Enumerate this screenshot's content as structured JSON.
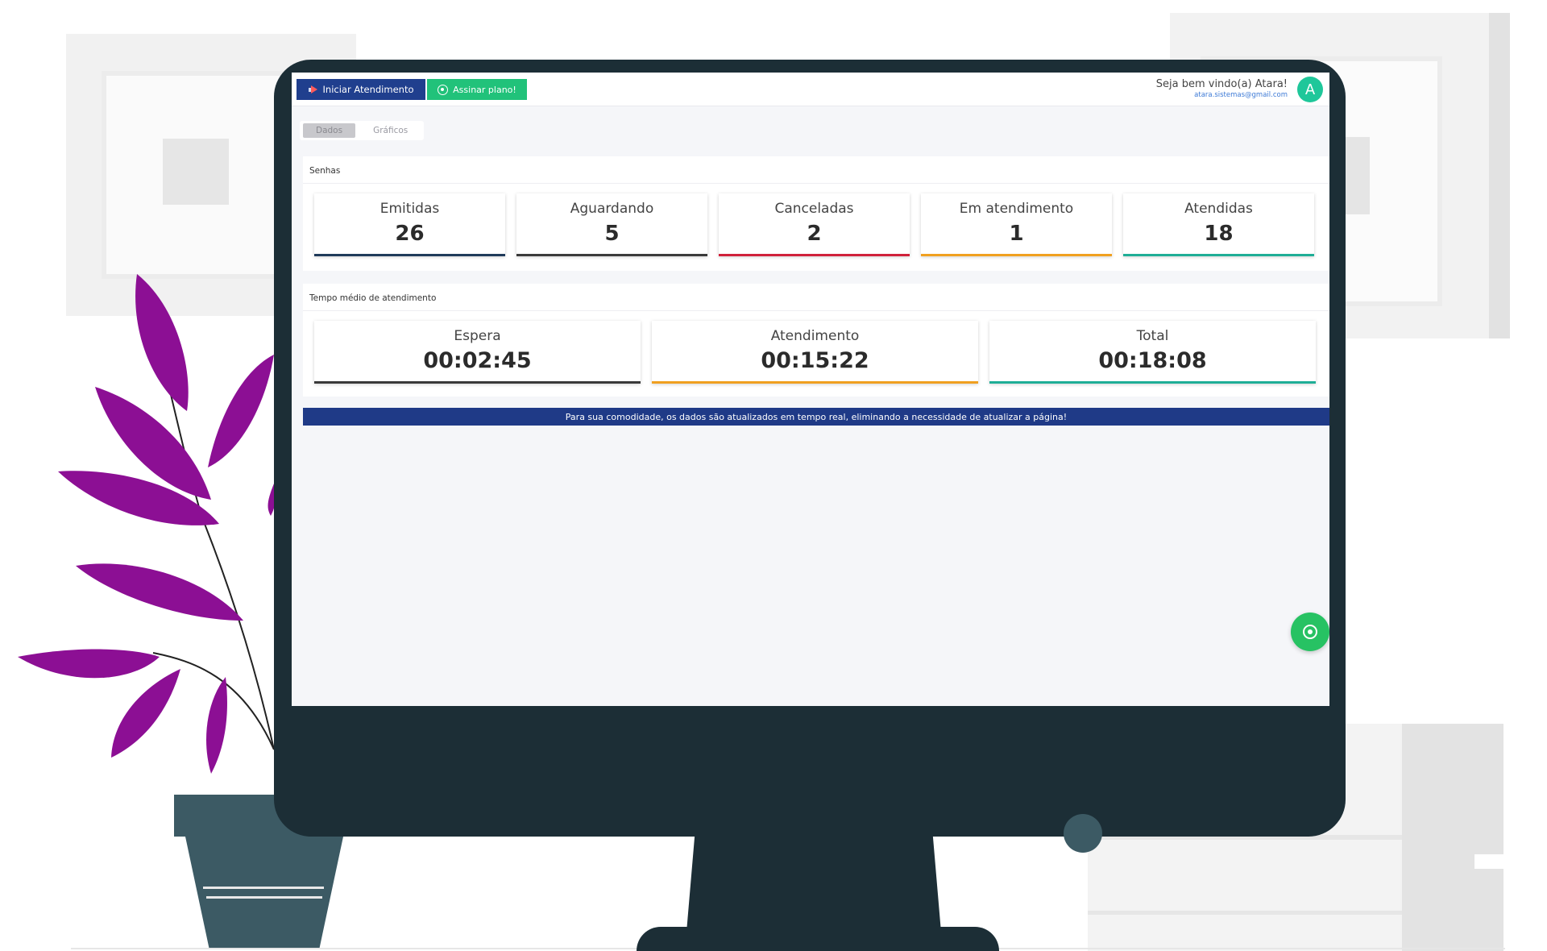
{
  "toolbar": {
    "start_label": "Iniciar Atendimento",
    "plan_label": "Assinar plano!"
  },
  "user": {
    "welcome": "Seja bem vindo(a) Atara!",
    "email": "atara.sistemas@gmail.com",
    "avatar_initial": "A"
  },
  "tabs": [
    {
      "label": "Dados",
      "active": true
    },
    {
      "label": "Gráficos",
      "active": false
    }
  ],
  "senhas": {
    "title": "Senhas",
    "cards": [
      {
        "label": "Emitidas",
        "value": "26",
        "color": "#1f3a5a"
      },
      {
        "label": "Aguardando",
        "value": "5",
        "color": "#3a3a3a"
      },
      {
        "label": "Canceladas",
        "value": "2",
        "color": "#d0213a"
      },
      {
        "label": "Em atendimento",
        "value": "1",
        "color": "#f0a020"
      },
      {
        "label": "Atendidas",
        "value": "18",
        "color": "#1fae96"
      }
    ]
  },
  "tempo": {
    "title": "Tempo médio de atendimento",
    "cards": [
      {
        "label": "Espera",
        "value": "00:02:45",
        "color": "#3a3a3a"
      },
      {
        "label": "Atendimento",
        "value": "00:15:22",
        "color": "#f0a020"
      },
      {
        "label": "Total",
        "value": "00:18:08",
        "color": "#1fae96"
      }
    ]
  },
  "banner": "Para sua comodidade, os dados são atualizados em tempo real, eliminando a necessidade de atualizar a página!",
  "icons": {
    "start": "megaphone-icon",
    "plan": "target-icon",
    "whatsapp": "whatsapp-icon"
  },
  "colors": {
    "primary": "#203f8e",
    "success": "#21c27a",
    "avatar": "#1fc79a",
    "whatsapp": "#27c263"
  }
}
